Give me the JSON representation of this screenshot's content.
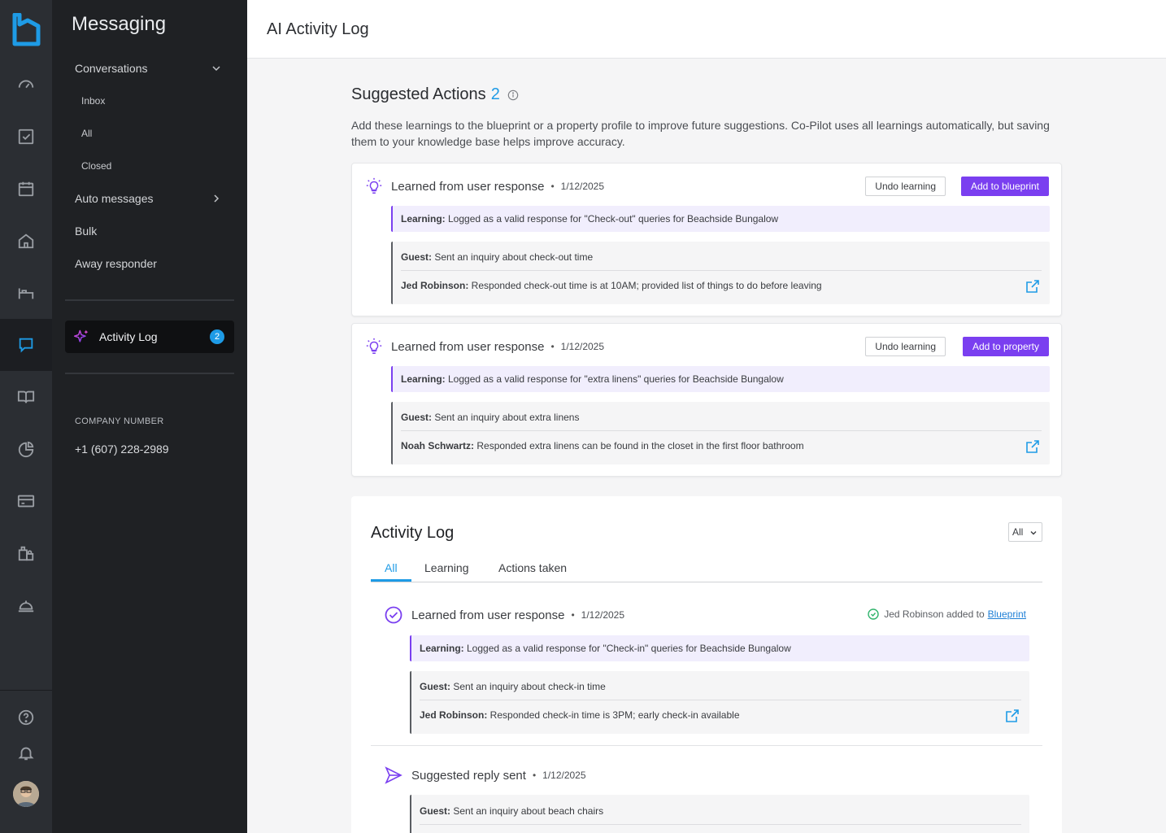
{
  "sidebar": {
    "title": "Messaging",
    "conversations": "Conversations",
    "inbox": "Inbox",
    "all": "All",
    "closed": "Closed",
    "auto_messages": "Auto messages",
    "bulk": "Bulk",
    "away_responder": "Away responder",
    "activity_log": "Activity Log",
    "activity_badge": "2",
    "company_number_label": "COMPANY NUMBER",
    "company_number": "+1 (607) 228-2989"
  },
  "header": {
    "title": "AI Activity Log"
  },
  "suggested": {
    "title": "Suggested Actions",
    "count": "2",
    "description": "Add these learnings to the blueprint or a property profile to improve future suggestions. Co-Pilot uses all learnings automatically, but saving them to your knowledge base helps improve accuracy.",
    "cards": [
      {
        "title": "Learned from user response",
        "dot": "•",
        "date": "1/12/2025",
        "undo": "Undo learning",
        "action": "Add to blueprint",
        "learning_label": "Learning:",
        "learning_text": " Logged as a valid response for \"Check-out\" queries for Beachside Bungalow",
        "guest_label": "Guest:",
        "guest_text": " Sent an inquiry about check-out time",
        "agent_label": "Jed Robinson:",
        "agent_text": " Responded check-out time is at 10AM; provided list of things to do before leaving"
      },
      {
        "title": "Learned from user response",
        "dot": "•",
        "date": "1/12/2025",
        "undo": "Undo learning",
        "action": "Add to property",
        "learning_label": "Learning:",
        "learning_text": " Logged as a valid response for \"extra linens\" queries for Beachside Bungalow",
        "guest_label": "Guest:",
        "guest_text": " Sent an inquiry about extra linens",
        "agent_label": "Noah Schwartz:",
        "agent_text": " Responded extra linens can be found in the closet in the first floor bathroom"
      }
    ]
  },
  "activity": {
    "title": "Activity Log",
    "filter": "All",
    "tabs": [
      "All",
      "Learning",
      "Actions taken"
    ],
    "entry1": {
      "title": "Learned from user response",
      "dot": "•",
      "date": "1/12/2025",
      "added_text": "Jed Robinson added to",
      "added_link": "Blueprint",
      "learning_label": "Learning:",
      "learning_text": " Logged as a valid response for \"Check-in\" queries for Beachside Bungalow",
      "guest_label": "Guest:",
      "guest_text": " Sent an inquiry about check-in time",
      "agent_label": "Jed Robinson:",
      "agent_text": " Responded check-in time is 3PM; early check-in available"
    },
    "entry2": {
      "title": "Suggested reply sent",
      "dot": "•",
      "date": "1/12/2025",
      "guest_label": "Guest:",
      "guest_text": " Sent an inquiry about beach chairs"
    }
  },
  "colors": {
    "accent": "#1e9be6",
    "primary": "#7a3ff0",
    "rail": "#2b2e33",
    "sidebar": "#1f2124"
  },
  "icons": [
    "brand-logo",
    "dashboard-icon",
    "tasks-icon",
    "calendar-icon",
    "home-icon",
    "bed-icon",
    "messaging-icon",
    "guidebook-icon",
    "reports-icon",
    "payments-icon",
    "lock-icon",
    "concierge-icon",
    "help-icon",
    "bell-icon",
    "avatar"
  ]
}
